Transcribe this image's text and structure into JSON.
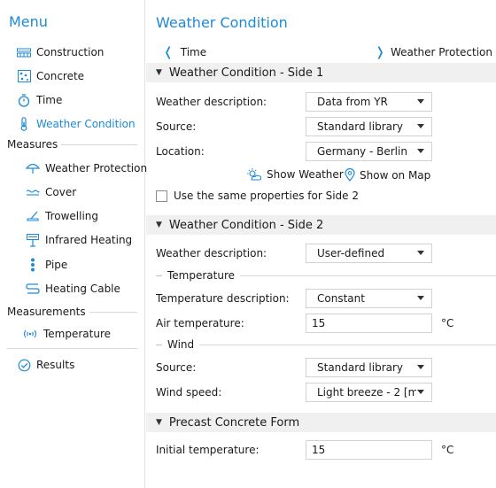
{
  "sidebar": {
    "title": "Menu",
    "items": [
      {
        "label": "Construction",
        "icon": "construction-icon"
      },
      {
        "label": "Concrete",
        "icon": "concrete-icon"
      },
      {
        "label": "Time",
        "icon": "stopwatch-icon"
      },
      {
        "label": "Weather Condition",
        "icon": "thermometer-icon",
        "active": true
      }
    ],
    "measures_label": "Measures",
    "measures": [
      {
        "label": "Weather Protection",
        "icon": "umbrella-icon"
      },
      {
        "label": "Cover",
        "icon": "cover-icon"
      },
      {
        "label": "Trowelling",
        "icon": "trowel-icon"
      },
      {
        "label": "Infrared Heating",
        "icon": "infrared-heater-icon"
      },
      {
        "label": "Pipe",
        "icon": "pipe-icon"
      },
      {
        "label": "Heating Cable",
        "icon": "heating-cable-icon"
      }
    ],
    "measurements_label": "Measurements",
    "measurements": [
      {
        "label": "Temperature",
        "icon": "sensor-signal-icon"
      }
    ],
    "results": {
      "label": "Results",
      "icon": "check-circle-icon"
    }
  },
  "main": {
    "title": "Weather Condition",
    "back_label": "Time",
    "next_label": "Weather Protection",
    "side1": {
      "header": "Weather Condition - Side 1",
      "weather_description_label": "Weather description:",
      "weather_description_value": "Data from YR",
      "source_label": "Source:",
      "source_value": "Standard library",
      "location_label": "Location:",
      "location_value": "Germany - Berlin",
      "show_weather_label": "Show Weather",
      "show_on_map_label": "Show on Map",
      "same_props_label": "Use the same properties for Side 2",
      "same_props_checked": false
    },
    "side2": {
      "header": "Weather Condition - Side 2",
      "weather_description_label": "Weather description:",
      "weather_description_value": "User-defined",
      "temperature_group": "Temperature",
      "temperature_description_label": "Temperature description:",
      "temperature_description_value": "Constant",
      "air_temperature_label": "Air temperature:",
      "air_temperature_value": "15",
      "air_temperature_unit": "°C",
      "wind_group": "Wind",
      "wind_source_label": "Source:",
      "wind_source_value": "Standard library",
      "wind_speed_label": "Wind speed:",
      "wind_speed_value": "Light breeze - 2 [m"
    },
    "precast": {
      "header": "Precast Concrete Form",
      "initial_temperature_label": "Initial temperature:",
      "initial_temperature_value": "15",
      "initial_temperature_unit": "°C"
    }
  },
  "colors": {
    "accent": "#1e8ad6",
    "section_bg": "#f0f0f0",
    "border": "#d2d2d2"
  }
}
